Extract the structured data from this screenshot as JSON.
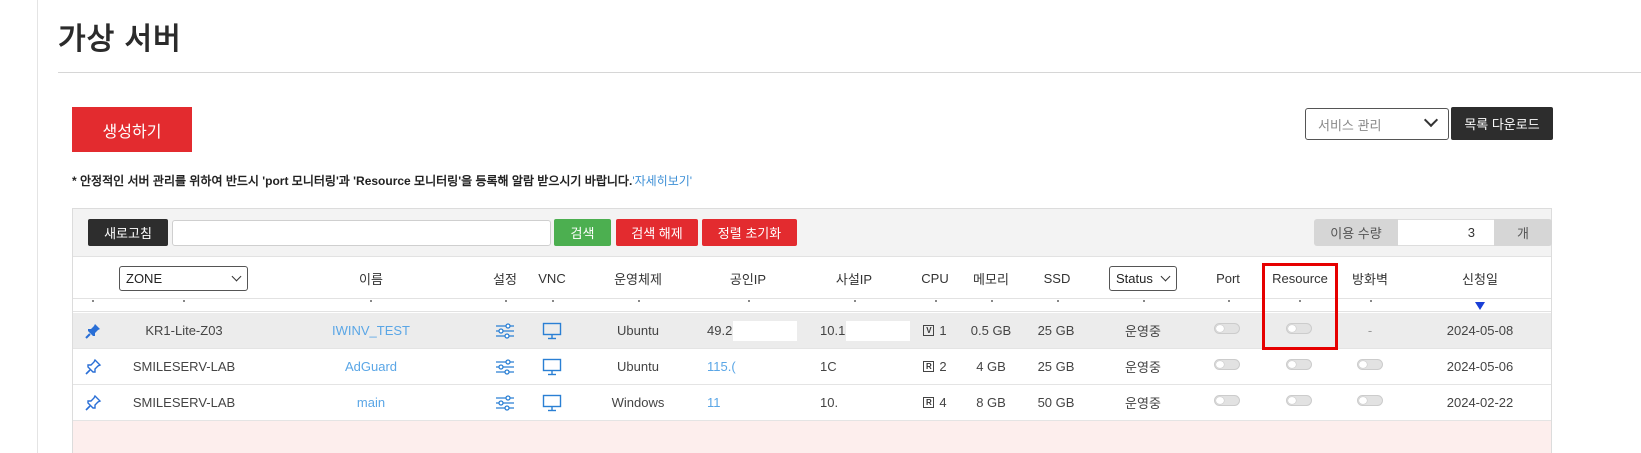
{
  "page": {
    "title": "가상 서버"
  },
  "actions": {
    "create_label": "생성하기",
    "service_select_value": "서비스 관리",
    "download_label": "목록 다운로드"
  },
  "notice": {
    "text": "* 안정적인 서버 관리를 위하여 반드시 'port 모니터링'과 'Resource 모니터링'을 등록해 알람 받으시기 바랍니다.",
    "link": "'자세히보기'"
  },
  "toolbar": {
    "refresh": "새로고침",
    "search_value": "",
    "search": "검색",
    "clear": "검색 해제",
    "reset_sort": "정렬 초기화",
    "usage_label": "이용 수량",
    "usage_value": "3",
    "usage_unit": "개"
  },
  "columns": {
    "zone": "ZONE",
    "name": "이름",
    "settings": "설정",
    "vnc": "VNC",
    "os": "운영체제",
    "public_ip": "공인IP",
    "private_ip": "사설IP",
    "cpu": "CPU",
    "memory": "메모리",
    "ssd": "SSD",
    "status": "Status",
    "port": "Port",
    "resource": "Resource",
    "firewall": "방화벽",
    "date": "신청일"
  },
  "rows": [
    {
      "pin": "filled",
      "zone": "KR1-Lite-Z03",
      "name": "IWINV_TEST",
      "os": "Ubuntu",
      "public_ip": "49.2",
      "private_ip": "10.1",
      "cpu_type": "V",
      "cpu": "1",
      "memory": "0.5 GB",
      "ssd": "25 GB",
      "status": "운영중",
      "firewall": "-",
      "date": "2024-05-08"
    },
    {
      "pin": "outline",
      "zone": "SMILESERV-LAB",
      "name": "AdGuard",
      "os": "Ubuntu",
      "public_ip": "115.(",
      "private_ip": "1C",
      "cpu_type": "R",
      "cpu": "2",
      "memory": "4 GB",
      "ssd": "25 GB",
      "status": "운영중",
      "firewall": "",
      "date": "2024-05-06"
    },
    {
      "pin": "outline",
      "zone": "SMILESERV-LAB",
      "name": "main",
      "os": "Windows",
      "public_ip": "11",
      "private_ip": "10.",
      "cpu_type": "R",
      "cpu": "4",
      "memory": "8 GB",
      "ssd": "50 GB",
      "status": "운영중",
      "firewall": "",
      "date": "2024-02-22"
    }
  ],
  "colors": {
    "accent_red": "#e32b2f",
    "accent_green": "#4caf50",
    "link_blue": "#5aa6e6",
    "highlight_red": "#e60000"
  }
}
